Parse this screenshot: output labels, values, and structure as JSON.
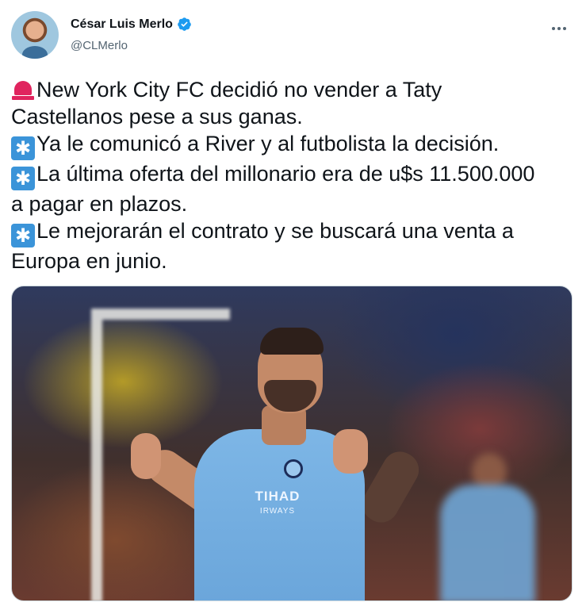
{
  "author": {
    "display_name": "César Luis Merlo",
    "handle": "@CLMerlo",
    "verified": true
  },
  "tweet": {
    "lines": [
      {
        "emoji": "siren-icon",
        "text": "New York City FC decidió no vender a Taty"
      },
      {
        "emoji": "",
        "text": "Castellanos pese a sus ganas."
      },
      {
        "emoji": "asterisk-icon",
        "text": "Ya le comunicó a River y al futbolista la decisión."
      },
      {
        "emoji": "asterisk-icon",
        "text": "La última oferta del millonario era de u$s 11.500.000"
      },
      {
        "emoji": "",
        "text": "a pagar en plazos."
      },
      {
        "emoji": "asterisk-icon",
        "text": "Le mejorarán el contrato y se buscará una venta a"
      },
      {
        "emoji": "",
        "text": "Europa en junio."
      }
    ]
  },
  "media": {
    "jersey_sponsor": "TIHAD",
    "jersey_sponsor_sub": "IRWAYS"
  },
  "colors": {
    "verified": "#1d9bf0",
    "asterisk_emoji": "#3b94d9",
    "siren_emoji": "#e0245e",
    "secondary_text": "#536471"
  }
}
